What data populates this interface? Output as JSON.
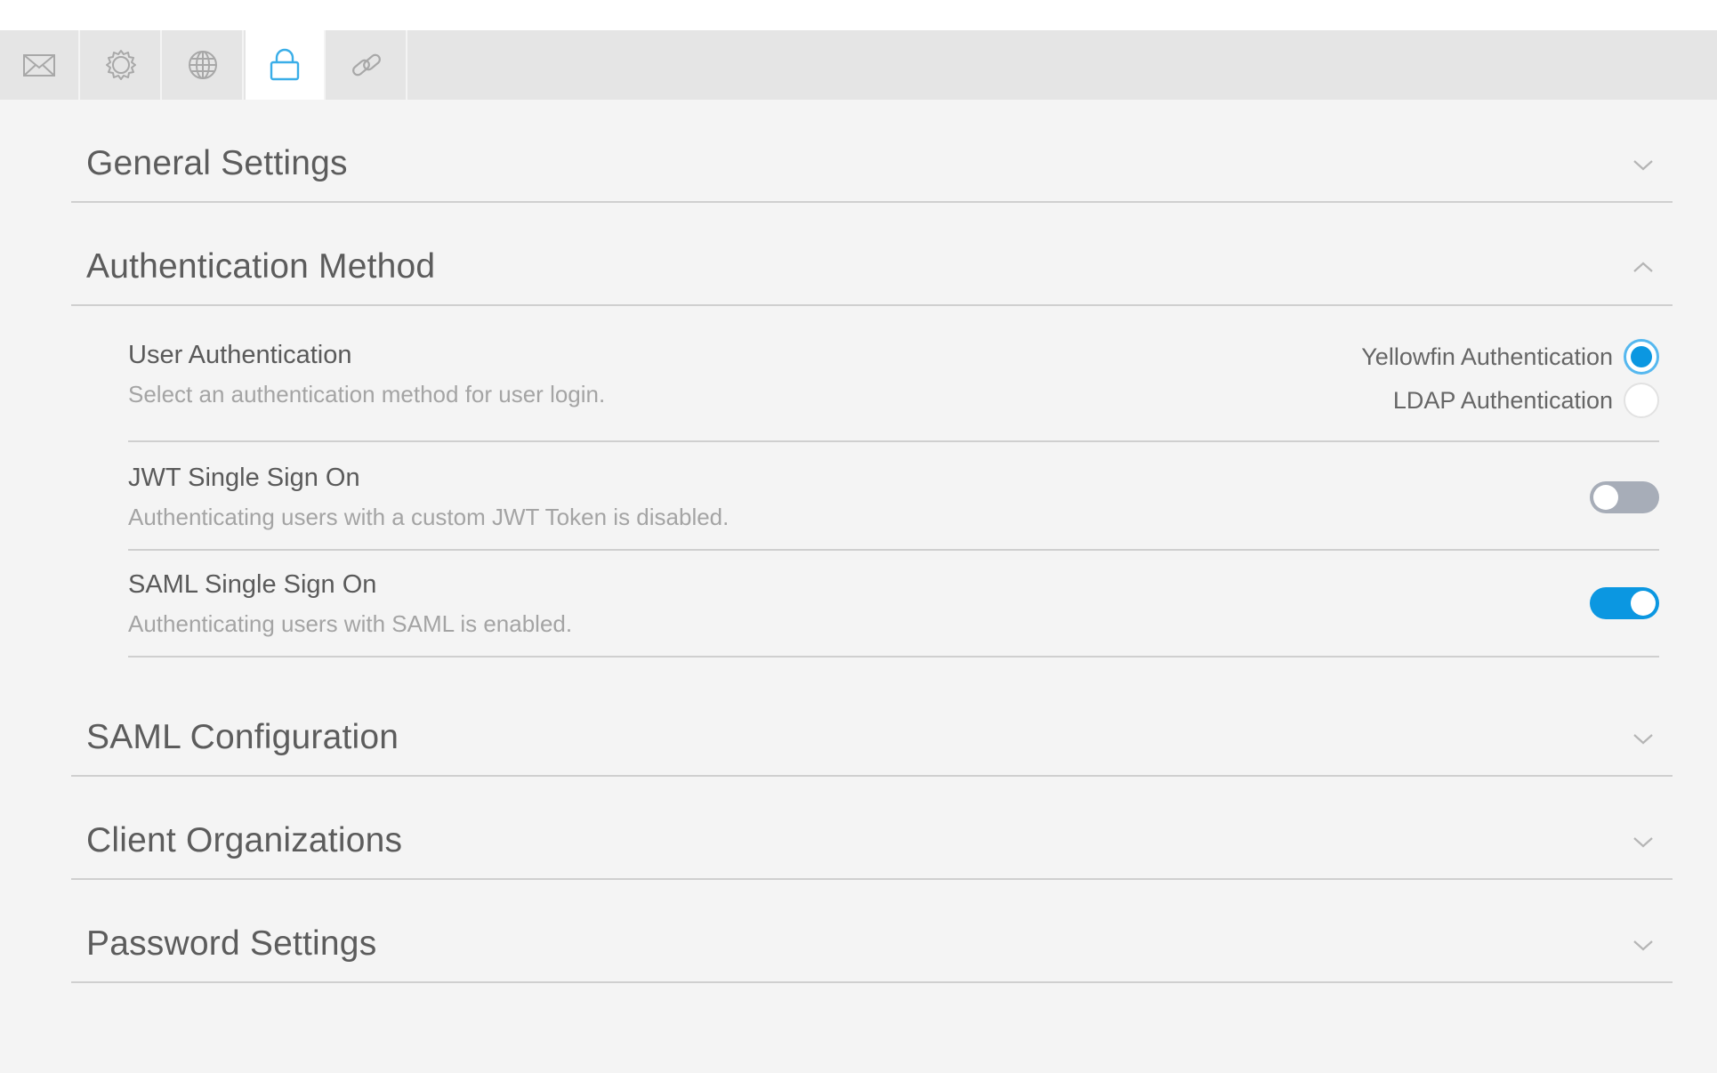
{
  "tabs": [
    {
      "icon": "mail-icon",
      "active": false
    },
    {
      "icon": "gear-icon",
      "active": false
    },
    {
      "icon": "globe-icon",
      "active": false
    },
    {
      "icon": "lock-icon",
      "active": true
    },
    {
      "icon": "link-icon",
      "active": false
    }
  ],
  "colors": {
    "accent": "#0b97e1",
    "toggle_off": "#a7adb8",
    "tab_bar": "#e5e5e5",
    "background": "#f4f4f4"
  },
  "sections": {
    "general": {
      "title": "General Settings",
      "expanded": false
    },
    "auth": {
      "title": "Authentication Method",
      "expanded": true
    },
    "saml_config": {
      "title": "SAML Configuration",
      "expanded": false
    },
    "client_orgs": {
      "title": "Client Organizations",
      "expanded": false
    },
    "password": {
      "title": "Password Settings",
      "expanded": false
    }
  },
  "auth": {
    "user_auth": {
      "label": "User Authentication",
      "description": "Select an authentication method for user login.",
      "options": [
        {
          "label": "Yellowfin Authentication",
          "selected": true
        },
        {
          "label": "LDAP Authentication",
          "selected": false
        }
      ]
    },
    "jwt": {
      "label": "JWT Single Sign On",
      "description": "Authenticating users with a custom JWT Token is disabled.",
      "enabled": false
    },
    "saml": {
      "label": "SAML Single Sign On",
      "description": "Authenticating users with SAML is enabled.",
      "enabled": true
    }
  }
}
